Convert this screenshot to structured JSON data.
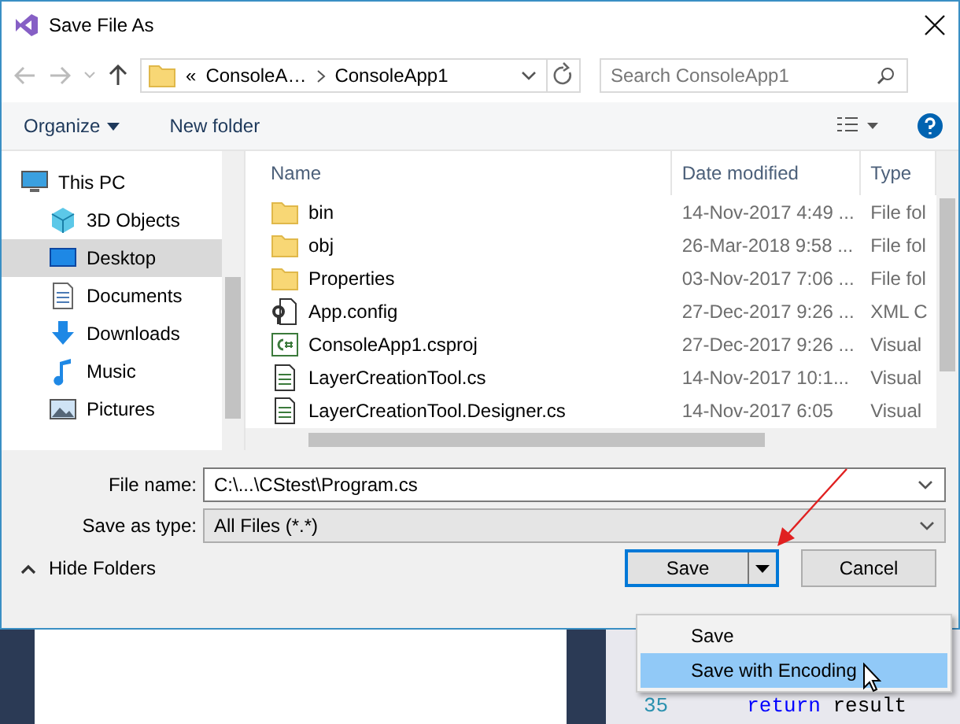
{
  "window": {
    "title": "Save File As"
  },
  "address": {
    "overflow": "«",
    "path": [
      "ConsoleA…",
      "ConsoleApp1"
    ]
  },
  "search": {
    "placeholder": "Search ConsoleApp1"
  },
  "toolbar": {
    "buttons": [
      {
        "label": "Organize",
        "dropdown": true
      },
      {
        "label": "New folder",
        "dropdown": false
      }
    ]
  },
  "sidebar": {
    "items": [
      {
        "label": "This PC",
        "kind": "pc",
        "selected": false,
        "children": [
          {
            "label": "3D Objects",
            "kind": "cube",
            "selected": false
          },
          {
            "label": "Desktop",
            "kind": "desktop",
            "selected": true
          },
          {
            "label": "Documents",
            "kind": "document",
            "selected": false
          },
          {
            "label": "Downloads",
            "kind": "download",
            "selected": false
          },
          {
            "label": "Music",
            "kind": "music",
            "selected": false
          },
          {
            "label": "Pictures",
            "kind": "picture",
            "selected": false
          }
        ]
      }
    ]
  },
  "file_list": {
    "columns": [
      "Name",
      "Date modified",
      "Type"
    ],
    "rows": [
      {
        "name": "bin",
        "date": "14-Nov-2017 4:49 ...",
        "type": "File fol",
        "kind": "folder"
      },
      {
        "name": "obj",
        "date": "26-Mar-2018 9:58 ...",
        "type": "File fol",
        "kind": "folder"
      },
      {
        "name": "Properties",
        "date": "03-Nov-2017 7:06 ...",
        "type": "File fol",
        "kind": "folder"
      },
      {
        "name": "App.config",
        "date": "27-Dec-2017 9:26 ...",
        "type": "XML C",
        "kind": "config"
      },
      {
        "name": "ConsoleApp1.csproj",
        "date": "27-Dec-2017 9:26 ...",
        "type": "Visual",
        "kind": "csproj"
      },
      {
        "name": "LayerCreationTool.cs",
        "date": "14-Nov-2017 10:1...",
        "type": "Visual",
        "kind": "code"
      },
      {
        "name": "LayerCreationTool.Designer.cs",
        "date": "14-Nov-2017 6:05",
        "type": "Visual",
        "kind": "code"
      }
    ]
  },
  "form": {
    "file_name": {
      "label": "File name:",
      "value": "C:\\...\\CStest\\Program.cs"
    },
    "save_as_type": {
      "label": "Save as type:",
      "value": "All Files (*.*)"
    }
  },
  "hide_folders": "Hide Folders",
  "buttons": [
    {
      "label": "Save",
      "kind": "split"
    },
    {
      "label": "Cancel",
      "kind": "plain"
    }
  ],
  "save_menu": {
    "items": [
      {
        "label": "Save",
        "selected": false
      },
      {
        "label": "Save with Encoding",
        "selected": true
      }
    ]
  },
  "editor": {
    "line_number": "35",
    "keyword": "return",
    "code": "result"
  }
}
